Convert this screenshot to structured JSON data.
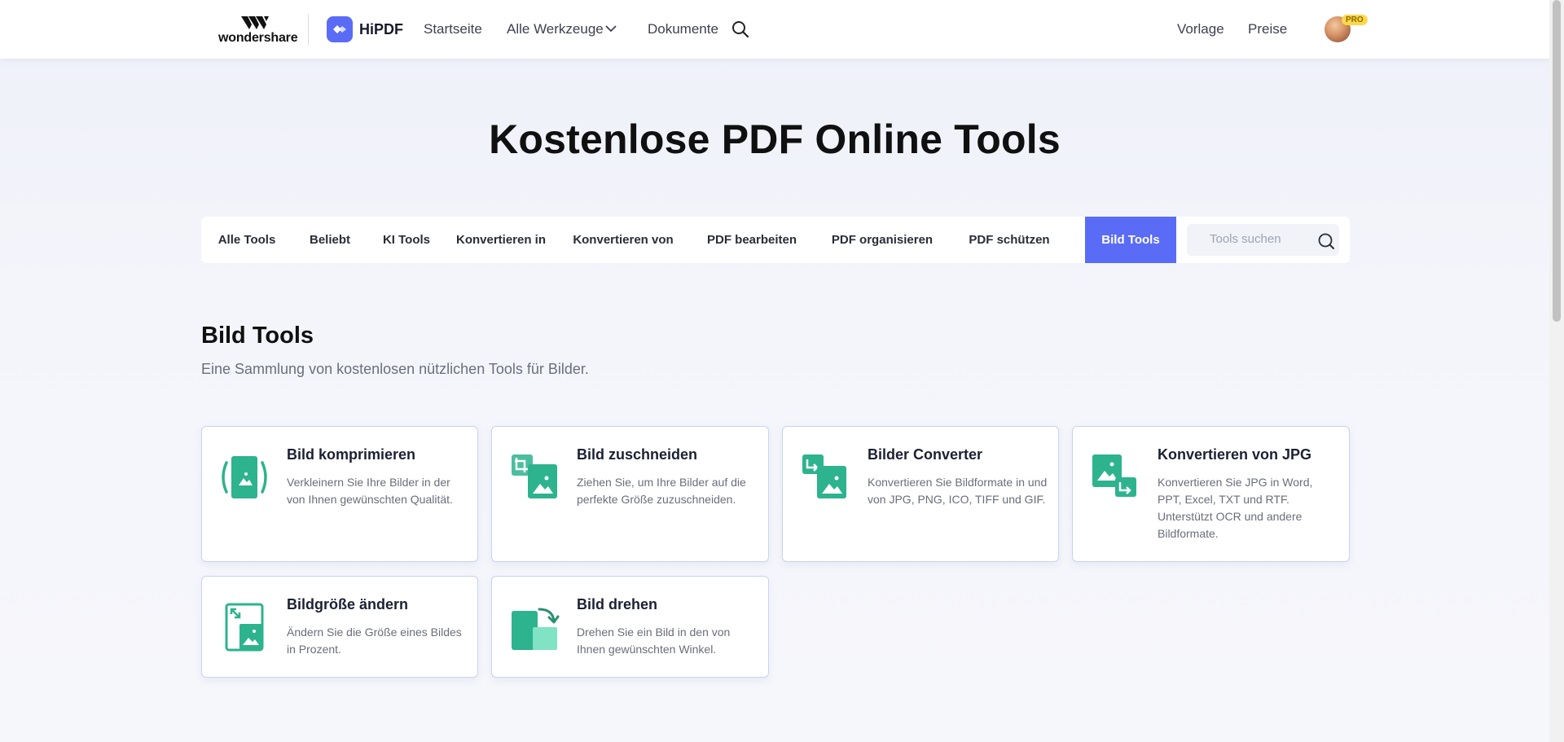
{
  "header": {
    "brand": "wondershare",
    "product": "HiPDF",
    "nav": {
      "home": "Startseite",
      "all_tools": "Alle Werkzeuge",
      "documents": "Dokumente",
      "template": "Vorlage",
      "pricing": "Preise"
    },
    "pro_badge": "PRO"
  },
  "hero": {
    "title": "Kostenlose PDF Online Tools"
  },
  "tabs": [
    {
      "label": "Alle Tools"
    },
    {
      "label": "Beliebt"
    },
    {
      "label": "KI Tools"
    },
    {
      "label": "Konvertieren in"
    },
    {
      "label": "Konvertieren von"
    },
    {
      "label": "PDF bearbeiten"
    },
    {
      "label": "PDF organisieren"
    },
    {
      "label": "PDF schützen"
    },
    {
      "label": "Bild Tools",
      "active": true
    }
  ],
  "search": {
    "placeholder": "Tools suchen"
  },
  "section": {
    "title": "Bild Tools",
    "subtitle": "Eine Sammlung von kostenlosen nützlichen Tools für Bilder."
  },
  "cards": [
    {
      "title": "Bild komprimieren",
      "desc": "Verkleinern Sie Ihre Bilder in der von Ihnen gewünschten Qualität.",
      "icon": "compress-image-icon"
    },
    {
      "title": "Bild zuschneiden",
      "desc": "Ziehen Sie, um Ihre Bilder auf die perfekte Größe zuzuschneiden.",
      "icon": "crop-image-icon"
    },
    {
      "title": "Bilder Converter",
      "desc": "Konvertieren Sie Bildformate in und von JPG, PNG, ICO, TIFF und GIF.",
      "icon": "convert-image-icon"
    },
    {
      "title": "Konvertieren von JPG",
      "desc": "Konvertieren Sie JPG in Word, PPT, Excel, TXT und RTF. Unterstützt OCR und andere Bildformate.",
      "icon": "convert-from-jpg-icon"
    },
    {
      "title": "Bildgröße ändern",
      "desc": "Ändern Sie die Größe eines Bildes in Prozent.",
      "icon": "resize-image-icon"
    },
    {
      "title": "Bild drehen",
      "desc": "Drehen Sie ein Bild in den von Ihnen gewünschten Winkel.",
      "icon": "rotate-image-icon"
    }
  ],
  "colors": {
    "accent": "#5a6cf6",
    "icon_green": "#2db38e",
    "icon_green_light": "#7fe3c4",
    "pro_badge": "#ffd84a"
  }
}
